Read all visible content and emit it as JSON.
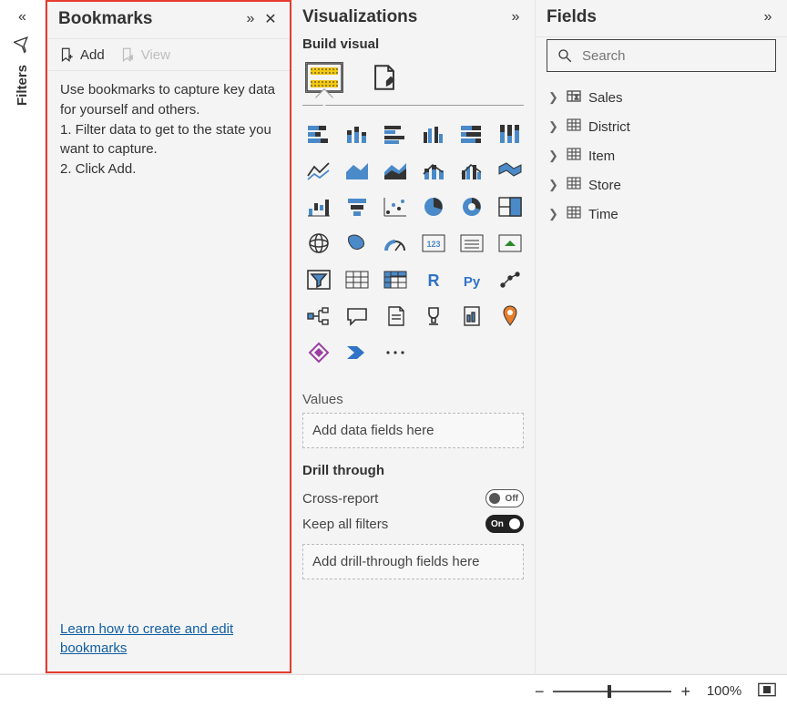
{
  "filters": {
    "label": "Filters"
  },
  "bookmarks": {
    "title": "Bookmarks",
    "add": "Add",
    "view": "View",
    "help_intro": "Use bookmarks to capture key data for yourself and others.",
    "step1": "1. Filter data to get to the state you want to capture.",
    "step2": "2. Click Add.",
    "learn_link": "Learn how to create and edit bookmarks"
  },
  "viz": {
    "title": "Visualizations",
    "subtitle": "Build visual",
    "types": [
      "stacked-bar",
      "stacked-column",
      "clustered-bar",
      "clustered-column",
      "100-stacked-bar",
      "100-stacked-column",
      "line",
      "area",
      "stacked-area",
      "line-stacked-column",
      "line-clustered-column",
      "ribbon",
      "waterfall",
      "funnel",
      "scatter",
      "pie",
      "donut",
      "treemap",
      "map",
      "filled-map",
      "gauge",
      "card",
      "multi-row-card",
      "kpi",
      "slicer",
      "table",
      "matrix",
      "r-visual",
      "py-visual",
      "key-influencers",
      "decomposition-tree",
      "qna",
      "smart-narrative",
      "goals",
      "paginated",
      "arcgis",
      "powerapps",
      "power-automate",
      "more"
    ],
    "values_label": "Values",
    "values_drop": "Add data fields here",
    "drill_label": "Drill through",
    "cross_report": "Cross-report",
    "cross_report_state": "Off",
    "keep_filters": "Keep all filters",
    "keep_filters_state": "On",
    "drill_drop": "Add drill-through fields here"
  },
  "fields": {
    "title": "Fields",
    "search_placeholder": "Search",
    "tables": [
      "Sales",
      "District",
      "Item",
      "Store",
      "Time"
    ]
  },
  "status": {
    "zoom": "100%"
  }
}
